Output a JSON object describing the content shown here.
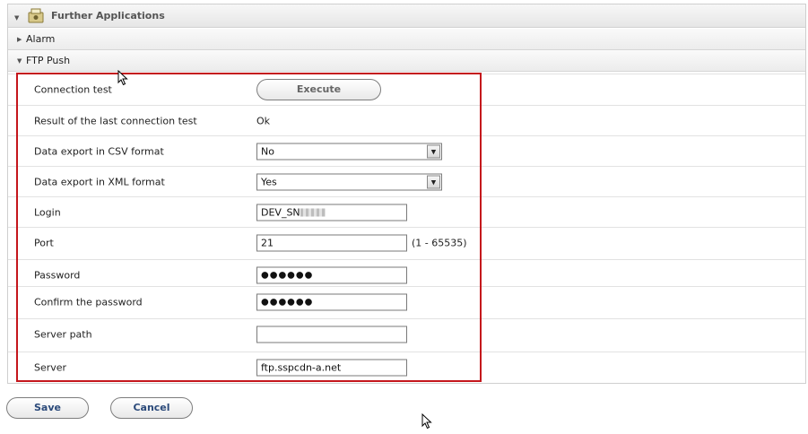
{
  "sections": {
    "further_applications": "Further Applications",
    "alarm": "Alarm",
    "ftp_push": "FTP Push"
  },
  "form": {
    "connection_test": {
      "label": "Connection test",
      "button": "Execute"
    },
    "last_result": {
      "label": "Result of the last connection test",
      "value": "Ok"
    },
    "csv_export": {
      "label": "Data export in CSV format",
      "value": "No"
    },
    "xml_export": {
      "label": "Data export in XML format",
      "value": "Yes"
    },
    "login": {
      "label": "Login",
      "value": "DEV_SN"
    },
    "port": {
      "label": "Port",
      "value": "21",
      "hint": "(1 - 65535)"
    },
    "password": {
      "label": "Password",
      "value": "●●●●●●"
    },
    "confirm_password": {
      "label": "Confirm the password",
      "value": "●●●●●●"
    },
    "server_path": {
      "label": "Server path",
      "value": ""
    },
    "server": {
      "label": "Server",
      "value": "ftp.sspcdn-a.net"
    }
  },
  "actions": {
    "save": "Save",
    "cancel": "Cancel"
  },
  "colors": {
    "highlight_border": "#c4161c",
    "header_bg": "#e6e6e6"
  }
}
